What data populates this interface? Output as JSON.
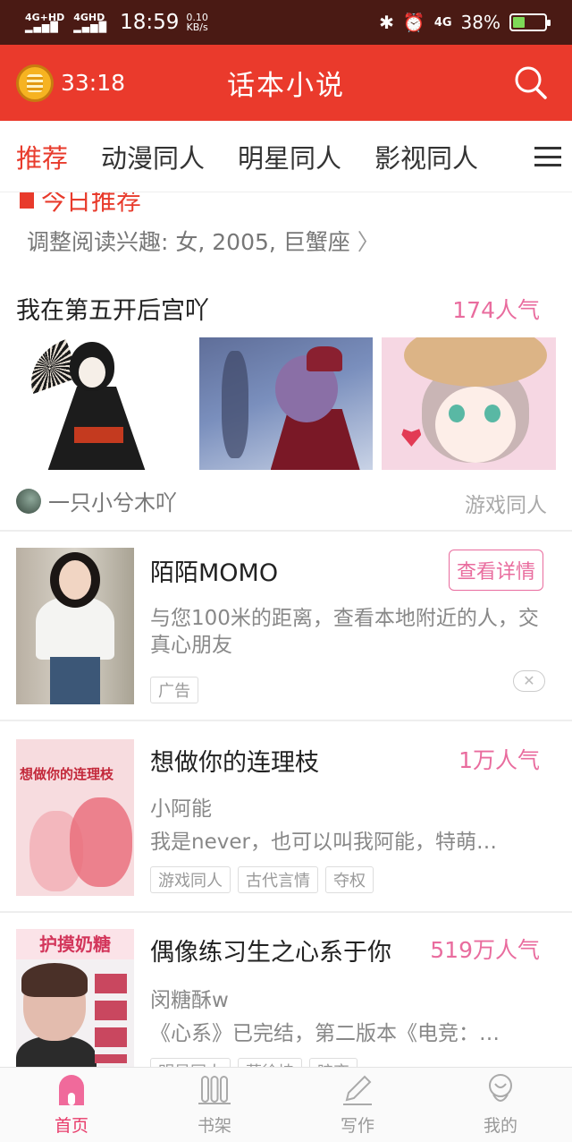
{
  "status_bar": {
    "signal_1": "4G+HD",
    "signal_2": "4GHD",
    "time": "18:59",
    "speed_value": "0.10",
    "speed_unit": "KB/s",
    "network": "4G",
    "battery": "38%",
    "battery_level": 0.38
  },
  "app_bar": {
    "timer": "33:18",
    "title": "话本小说"
  },
  "tabs": [
    "推荐",
    "动漫同人",
    "明星同人",
    "影视同人"
  ],
  "active_tab": 0,
  "content": {
    "partial_header": "今日推荐",
    "interest_text": "调整阅读兴趣: 女, 2005, 巨蟹座",
    "feature": {
      "title": "我在第五开后宫吖",
      "popularity": "174人气",
      "author": "一只小兮木吖",
      "genre": "游戏同人"
    },
    "ad": {
      "title": "陌陌MOMO",
      "button": "查看详情",
      "description": "与您100米的距离，查看本地附近的人，交真心朋友",
      "tag": "广告",
      "close": "✕"
    },
    "books": [
      {
        "title": "想做你的连理枝",
        "popularity": "1万人气",
        "author": "小阿能",
        "description": "我是never，也可以叫我阿能，特萌…",
        "tags": [
          "游戏同人",
          "古代言情",
          "夺权"
        ],
        "cover_text": "想做你的连理枝"
      },
      {
        "title": "偶像练习生之心系于你",
        "popularity": "519万人气",
        "author": "闵糖酥w",
        "description": "《心系》已完结，第二版本《电竞：…",
        "tags": [
          "明星同人",
          "蔡徐坤",
          "暗恋"
        ],
        "cover_text": "护摸奶糖"
      }
    ]
  },
  "bottom_nav": [
    {
      "label": "首页",
      "icon": "home-icon"
    },
    {
      "label": "书架",
      "icon": "bookshelf-icon"
    },
    {
      "label": "写作",
      "icon": "pencil-icon"
    },
    {
      "label": "我的",
      "icon": "profile-icon"
    }
  ],
  "colors": {
    "accent_red": "#ea3a2c",
    "pink": "#e96c9e",
    "status_bar": "#4a1a14"
  }
}
